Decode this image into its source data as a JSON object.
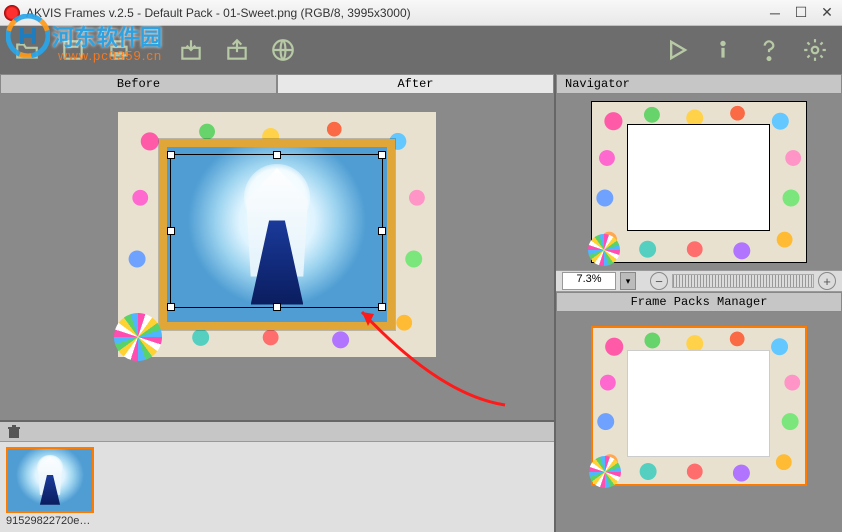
{
  "title": "AKVIS Frames v.2.5 - Default Pack - 01-Sweet.png (RGB/8, 3995x3000)",
  "watermark": {
    "text": "河东软件园",
    "sub": "www.pc0359.cn"
  },
  "tabs": {
    "before": "Before",
    "after": "After"
  },
  "navigator": {
    "title": "Navigator"
  },
  "zoom": {
    "value": "7.3%"
  },
  "packs": {
    "title": "Frame Packs Manager"
  },
  "thumb": {
    "filename": "91529822720e0cf..."
  },
  "icons": {
    "open": "open-icon",
    "save": "save-icon",
    "print": "print-icon",
    "import": "import-icon",
    "export": "export-icon",
    "web": "web-icon",
    "run": "run-icon",
    "info": "info-icon",
    "help": "help-icon",
    "prefs": "prefs-icon"
  },
  "colors": {
    "accent": "#ff7b00",
    "toolbar": "#6d6d6d",
    "canvas": "#8a8a8a"
  }
}
